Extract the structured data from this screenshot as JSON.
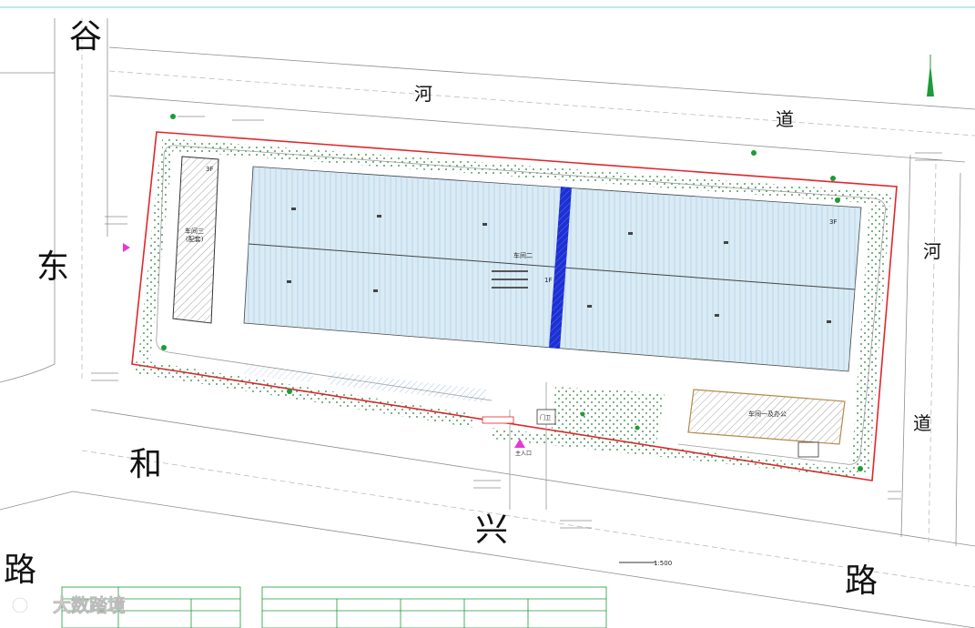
{
  "roads": {
    "gu": "谷",
    "dong": "东",
    "he_left": "和",
    "xing": "兴",
    "lu_left": "路",
    "lu_right": "路",
    "he_top": "河",
    "dao_top": "道",
    "he_right": "河",
    "dao_right": "道"
  },
  "buildings": {
    "workshop_main": "车间二",
    "workshop_main_3f": "3F",
    "workshop_main_1f": "1F",
    "warehouse_left": "车间三",
    "warehouse_left_sub": "(配套)",
    "warehouse_left_floor": "3F",
    "office": "车间一及办公",
    "gate": "门卫",
    "main_entrance": "主入口"
  },
  "scale_label": "1:500",
  "colors": {
    "redline": "#e0262b",
    "building_fill": "#d9ebf5",
    "roof_line": "#9fc4dc",
    "firewall": "#1f2fd6",
    "hatch": "#8a8a8a",
    "green": "#1c9b3a",
    "magenta": "#e23ad6"
  },
  "watermark": "大数踏境"
}
